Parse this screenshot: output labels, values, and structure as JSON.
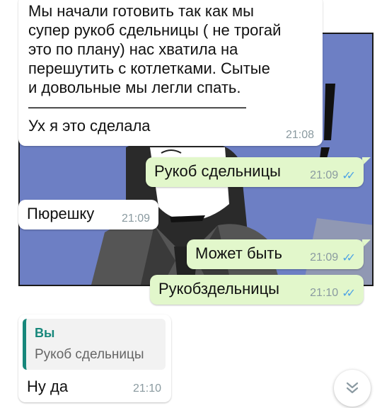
{
  "messages": [
    {
      "text": "Мы начали готовить так как мы\nсупер рукоб сдельницы ( не трогай\nэто по плану) нас хватила на\nперешутить с котлетками. Сытые\nи довольные мы легли спать.\n——————————————\nУх я это сделала",
      "time": "21:08"
    },
    {
      "text": "Рукоб сдельницы",
      "time": "21:09",
      "ticks": "✓✓"
    },
    {
      "text": "Пюрешку",
      "time": "21:09"
    },
    {
      "text": "Может быть",
      "time": "21:09",
      "ticks": "✓✓"
    },
    {
      "text": "Рукобздельницы",
      "time": "21:10",
      "ticks": "✓✓"
    }
  ],
  "reply": {
    "quote_author": "Вы",
    "quote_text": "Рукоб сдельницы",
    "text": "Ну да",
    "time": "21:10"
  },
  "icons": {
    "scroll_down": "double-chevron-down-icon",
    "read_receipt": "double-check-icon"
  },
  "colors": {
    "outgoing_bubble": "#e2f7cb",
    "incoming_bubble": "#ffffff",
    "quote_accent": "#17877b",
    "ticks": "#4fa4e5",
    "wallpaper": "#6d7fc4"
  }
}
